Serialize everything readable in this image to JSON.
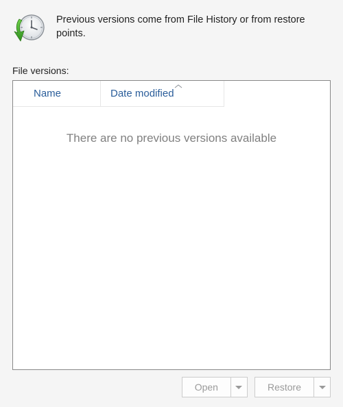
{
  "header": {
    "description": "Previous versions come from File History or from restore points."
  },
  "list": {
    "label": "File versions:",
    "columns": {
      "name": "Name",
      "date": "Date modified"
    },
    "empty_message": "There are no previous versions available"
  },
  "buttons": {
    "open": "Open",
    "restore": "Restore"
  }
}
